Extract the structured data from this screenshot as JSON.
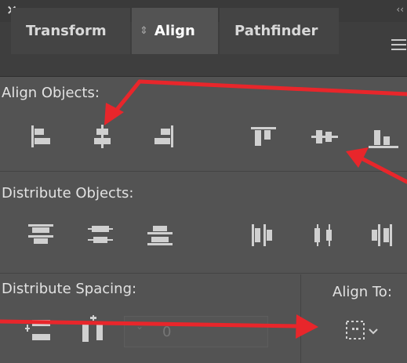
{
  "panel": {
    "close_glyph": "×",
    "collapse_glyph": "‹‹",
    "menu_icon": "hamburger-icon"
  },
  "tabs": [
    {
      "label": "Transform",
      "active": false
    },
    {
      "label": "Align",
      "active": true,
      "indicator": "⇕"
    },
    {
      "label": "Pathfinder",
      "active": false
    }
  ],
  "align_objects": {
    "label": "Align Objects:",
    "icons": [
      "horizontal-align-left-icon",
      "horizontal-align-center-icon",
      "horizontal-align-right-icon",
      "vertical-align-top-icon",
      "vertical-align-center-icon",
      "vertical-align-bottom-icon"
    ]
  },
  "distribute_objects": {
    "label": "Distribute Objects:",
    "icons": [
      "vertical-distribute-top-icon",
      "vertical-distribute-center-icon",
      "vertical-distribute-bottom-icon",
      "horizontal-distribute-left-icon",
      "horizontal-distribute-center-icon",
      "horizontal-distribute-right-icon"
    ]
  },
  "distribute_spacing": {
    "label": "Distribute Spacing:",
    "icons": [
      "vertical-distribute-space-icon",
      "horizontal-distribute-space-icon"
    ],
    "value": "0",
    "stepper_glyph": "⌃⌄"
  },
  "align_to": {
    "label": "Align To:",
    "icon": "align-to-selection-icon",
    "chevron": "⌄"
  },
  "colors": {
    "panel_bg": "#535353",
    "tabbar_bg": "#3e3e3e",
    "annotation_arrow": "#e8262b",
    "icon_fill": "#d0d0d0"
  }
}
